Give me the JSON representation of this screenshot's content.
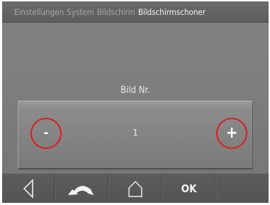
{
  "breadcrumb": [
    {
      "label": "Einstellungen",
      "current": false
    },
    {
      "label": "System",
      "current": false
    },
    {
      "label": "Bildschirm",
      "current": false
    },
    {
      "label": "Bildschirmschoner",
      "current": true
    }
  ],
  "setting": {
    "title": "Bild Nr.",
    "value": "1",
    "decrement_label": "-",
    "increment_label": "+"
  },
  "navbar": {
    "back_icon": "triangle-left-icon",
    "undo_icon": "curved-arrow-undo-icon",
    "home_icon": "house-outline-icon",
    "ok_label": "OK"
  },
  "colors": {
    "highlight_ring": "#e11b1b",
    "background": "#808080"
  }
}
